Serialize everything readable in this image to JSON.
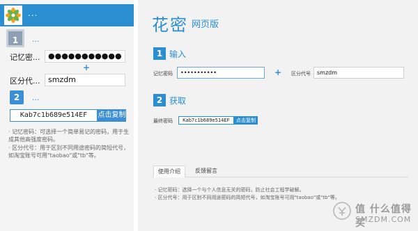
{
  "mobile": {
    "header_dots": "...",
    "step1": {
      "number": "1",
      "dots": "..."
    },
    "password_label": "记忆密...",
    "password_value": "●●●●●●●●●●●",
    "plus": "+",
    "code_label": "区分代...",
    "code_value": "smzdm",
    "step2": {
      "number": "2",
      "dots": "..."
    },
    "output_value": "Kab7c1b689e514EF",
    "copy_label": "点击复制",
    "note1": "· 记忆密码：可选择一个简单易记的密码，用于生成其他高强度密码。",
    "note2": "· 区分代号：用于区别不同用途密码的简短代号，如淘宝账号可用\"taobao\"或\"tb\"等。"
  },
  "desktop": {
    "brand": "花密",
    "brand_sub": "网页版",
    "step1": {
      "number": "1",
      "title": "输入"
    },
    "password_label": "记忆密码",
    "password_value": "•••••••••••",
    "plus": "+",
    "code_label": "区分代号",
    "code_value": "smzdm",
    "step2": {
      "number": "2",
      "title": "获取"
    },
    "output_label": "最终密码",
    "output_value": "Kab7c1b689e514EF",
    "copy_label": "点击复制",
    "tabs": [
      {
        "label": "使用介绍"
      },
      {
        "label": "反馈留言"
      }
    ],
    "note1": "· 记忆密码：选择一个与个人信息无关的密码，防止社会工程学破解。",
    "note2": "· 区分代号：用于区别不同用途密码的简短代号，如淘宝账号可用\"taobao\"或\"tb\"等。"
  },
  "watermark": {
    "text": "值 什么值得买",
    "sub": "SMZDM.COM"
  },
  "colors": {
    "accent": "#2b8ed0",
    "mobile_bg": "#f4f4f4",
    "desktop_bg": "#f2f2f2"
  },
  "icons": {
    "app_logo": "flower-logo-icon",
    "watermark_logo": "smzdm-logo-icon"
  }
}
